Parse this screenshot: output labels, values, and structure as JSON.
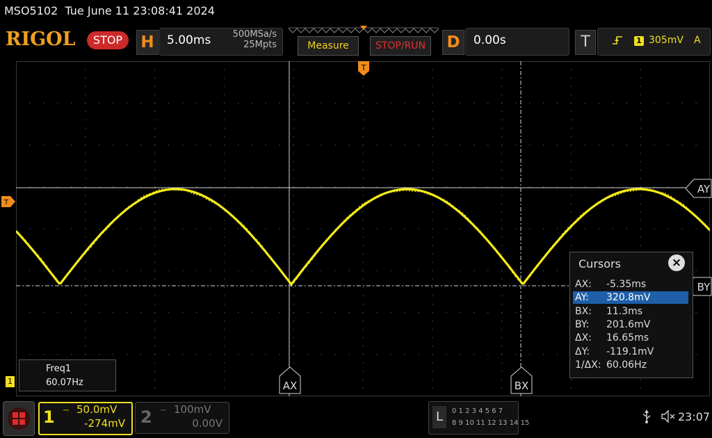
{
  "status": {
    "title": "MSO5102  Tue June 11 23:08:41 2024",
    "brand": "RIGOL",
    "run_state": "STOP"
  },
  "horizontal": {
    "letter": "H",
    "time_base": "5.00ms",
    "sample_rate": "500MSa/s",
    "memory_depth": "25Mpts"
  },
  "buttons": {
    "measure": "Measure",
    "stop_run": "STOP/RUN"
  },
  "delay": {
    "letter": "D",
    "value": "0.00s"
  },
  "trigger": {
    "letter": "T",
    "edge_icon": "rising-edge-icon",
    "source": "1",
    "level": "305mV",
    "mode": "A",
    "marker": "T"
  },
  "cursors": {
    "title": "Cursors",
    "close_icon": "close-icon",
    "rows": [
      {
        "k": "AX:",
        "v": "-5.35ms"
      },
      {
        "k": "AY:",
        "v": "320.8mV"
      },
      {
        "k": "BX:",
        "v": "11.3ms"
      },
      {
        "k": "BY:",
        "v": "201.6mV"
      },
      {
        "k": "ΔX:",
        "v": "16.65ms"
      },
      {
        "k": "ΔY:",
        "v": "-119.1mV"
      },
      {
        "k": "1/ΔX:",
        "v": "60.06Hz"
      }
    ],
    "selected_index": 1,
    "labels": {
      "ax": "AX",
      "bx": "BX",
      "ay": "AY",
      "by": "BY"
    }
  },
  "measurement": {
    "label": "Freq1",
    "value": "60.07Hz"
  },
  "channel1": {
    "number": "1",
    "scale": "50.0mV",
    "offset": "-274mV",
    "color": "#f0e020",
    "marker": "1"
  },
  "channel2": {
    "number": "2",
    "scale": "100mV",
    "offset": "0.00V"
  },
  "logic": {
    "letter": "L",
    "row1": "0 1 2 3   4 5 6 7",
    "row2": "8 9 10 11 12 13 14 15"
  },
  "system": {
    "usb_icon": "usb-icon",
    "speaker_icon": "speaker-muted-icon",
    "time": "23:07"
  }
}
